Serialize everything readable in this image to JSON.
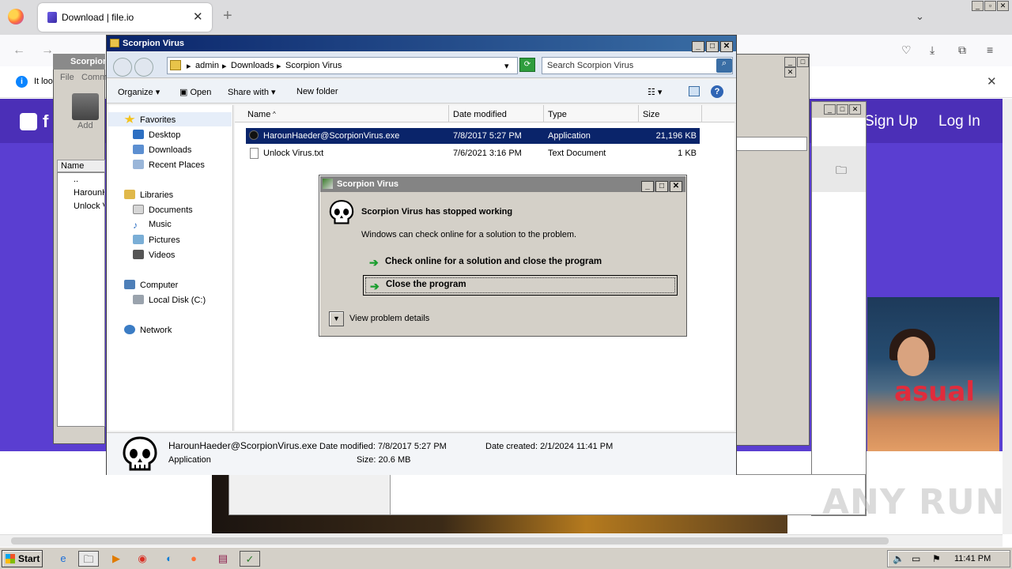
{
  "browser": {
    "tab_title": "Download | file.io",
    "tab_close": "✕",
    "new_tab": "+",
    "notification_text": "It loo",
    "notification_close": "✕"
  },
  "website": {
    "logo_text": "f",
    "signup": "Sign Up",
    "login": "Log In",
    "photo_text": "asual",
    "colors": {
      "header": "#4b2fb7",
      "body": "#5a3ed1"
    }
  },
  "winrar": {
    "title": "Scorpion",
    "menu": [
      "File",
      "Comm"
    ],
    "add_label": "Add",
    "column_name": "Name",
    "files": [
      "..",
      "HarounH",
      "Unlock V"
    ]
  },
  "explorer": {
    "title": "Scorpion Virus",
    "breadcrumb": [
      "admin",
      "Downloads",
      "Scorpion Virus"
    ],
    "search_placeholder": "Search Scorpion Virus",
    "toolbar": {
      "organize": "Organize",
      "open": "Open",
      "share_with": "Share with",
      "new_folder": "New folder"
    },
    "nav": {
      "favorites": "Favorites",
      "desktop": "Desktop",
      "downloads": "Downloads",
      "recent_places": "Recent Places",
      "libraries": "Libraries",
      "documents": "Documents",
      "music": "Music",
      "pictures": "Pictures",
      "videos": "Videos",
      "computer": "Computer",
      "local_disk": "Local Disk (C:)",
      "network": "Network"
    },
    "columns": {
      "name": "Name",
      "date_modified": "Date modified",
      "type": "Type",
      "size": "Size"
    },
    "files": [
      {
        "name": "HarounHaeder@ScorpionVirus.exe",
        "date": "7/8/2017 5:27 PM",
        "type": "Application",
        "size": "21,196 KB",
        "selected": true
      },
      {
        "name": "Unlock Virus.txt",
        "date": "7/6/2021 3:16 PM",
        "type": "Text Document",
        "size": "1 KB",
        "selected": false
      }
    ],
    "details": {
      "filename": "HarounHaeder@ScorpionVirus.exe",
      "type": "Application",
      "date_modified": "Date modified: 7/8/2017 5:27 PM",
      "size": "Size: 20.6 MB",
      "date_created": "Date created: 2/1/2024 11:41 PM"
    }
  },
  "dialog": {
    "title": "Scorpion Virus",
    "heading": "Scorpion Virus has stopped working",
    "subtext": "Windows can check online for a solution to the problem.",
    "option1": "Check online for a solution and close the program",
    "option2": "Close the program",
    "details": "View problem details"
  },
  "taskbar": {
    "start": "Start",
    "clock": "11:41 PM"
  },
  "watermark": "ANY RUN"
}
